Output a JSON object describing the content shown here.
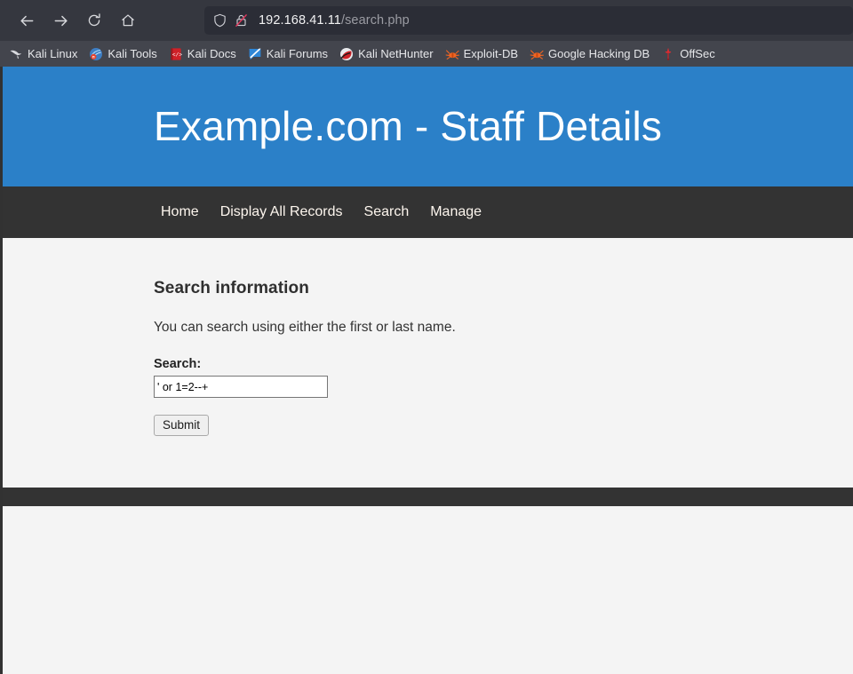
{
  "browser": {
    "toolbar": {
      "back_icon": "arrow-left-icon",
      "forward_icon": "arrow-right-icon",
      "reload_icon": "reload-icon",
      "home_icon": "home-icon",
      "shield_icon": "shield-icon",
      "insecure_icon": "broken-lock-icon"
    },
    "url": {
      "host": "192.168.41.11",
      "path": "/search.php"
    },
    "bookmarks": [
      {
        "label": "Kali Linux",
        "icon": "kali-dragon-icon"
      },
      {
        "label": "Kali Tools",
        "icon": "kali-tools-icon"
      },
      {
        "label": "Kali Docs",
        "icon": "kali-docs-icon"
      },
      {
        "label": "Kali Forums",
        "icon": "kali-forums-icon"
      },
      {
        "label": "Kali NetHunter",
        "icon": "kali-nethunter-icon"
      },
      {
        "label": "Exploit-DB",
        "icon": "exploit-db-icon"
      },
      {
        "label": "Google Hacking DB",
        "icon": "google-hacking-db-icon"
      },
      {
        "label": "OffSec",
        "icon": "offsec-icon"
      }
    ]
  },
  "page": {
    "banner_title": "Example.com - Staff Details",
    "nav": [
      {
        "label": "Home"
      },
      {
        "label": "Display All Records"
      },
      {
        "label": "Search"
      },
      {
        "label": "Manage"
      }
    ],
    "heading": "Search information",
    "description": "You can search using either the first or last name.",
    "form": {
      "search_label": "Search:",
      "search_value": "' or 1=2--+",
      "search_placeholder": "",
      "submit_label": "Submit"
    }
  },
  "colors": {
    "banner_blue": "#2b80c8",
    "nav_dark": "#333333",
    "page_background": "#f4f4f4",
    "chrome_dark": "#35373f",
    "bookmarks_bar": "#43454d"
  }
}
